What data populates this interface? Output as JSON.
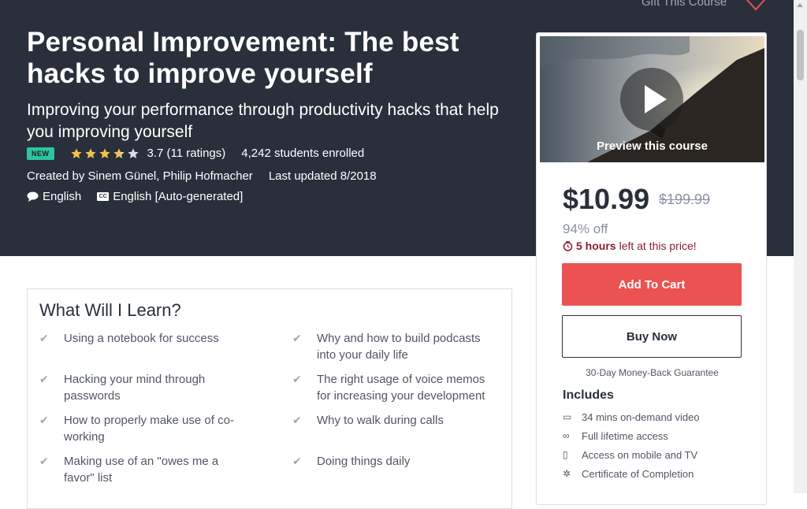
{
  "header": {
    "gift_label": "Gift This Course",
    "title": "Personal Improvement: The best hacks to improve yourself",
    "subtitle": "Improving your performance through productivity hacks that help you improving yourself",
    "badge": "NEW",
    "rating": "3.7 (11 ratings)",
    "rating_stars": 3.7,
    "students": "4,242 students enrolled",
    "created_by": "Created by Sinem Günel, Philip Hofmacher",
    "last_updated": "Last updated 8/2018",
    "language": "English",
    "captions": "English [Auto-generated]"
  },
  "sidebar": {
    "preview_label": "Preview this course",
    "price": "$10.99",
    "original_price": "$199.99",
    "discount": "94% off",
    "timer_strong": "5 hours",
    "timer_rest": "left at this price!",
    "add_to_cart": "Add To Cart",
    "buy_now": "Buy Now",
    "guarantee": "30-Day Money-Back Guarantee",
    "includes_heading": "Includes",
    "includes": [
      {
        "icon": "video-icon",
        "text": "34 mins on-demand video"
      },
      {
        "icon": "infinity-icon",
        "text": "Full lifetime access"
      },
      {
        "icon": "mobile-icon",
        "text": "Access on mobile and TV"
      },
      {
        "icon": "certificate-icon",
        "text": "Certificate of Completion"
      }
    ]
  },
  "learn": {
    "heading": "What Will I Learn?",
    "items": [
      "Using a notebook for success",
      "Why and how to build podcasts into your daily life",
      "Hacking your mind through passwords",
      "The right usage of voice memos for increasing your development",
      "How to properly make use of co-working",
      "Why to walk during calls",
      "Making use of an \"owes me a favor\" list",
      "Doing things daily"
    ]
  },
  "colors": {
    "hero_bg": "#29303b",
    "accent": "#ec5252",
    "new_badge": "#2ec4a1",
    "star": "#f4c150",
    "timer": "#8a1d31"
  }
}
